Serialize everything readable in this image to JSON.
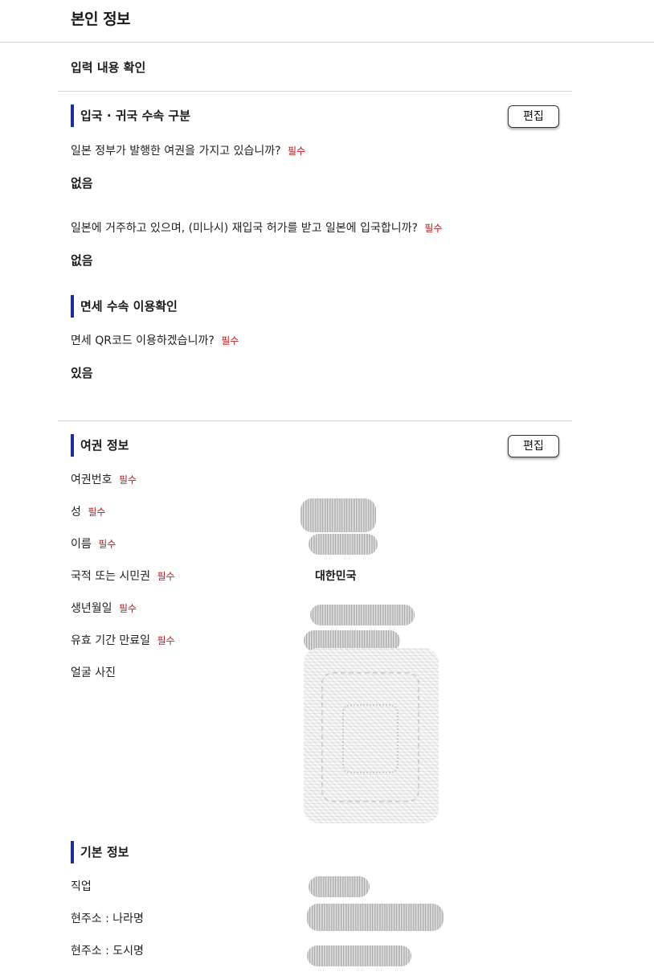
{
  "header": {
    "title": "본인 정보"
  },
  "confirm": {
    "title": "입력 내용 확인"
  },
  "required_label": "필수",
  "edit_label": "편집",
  "entry_section": {
    "title": "입국 · 귀국 수속 구분",
    "questions": [
      {
        "text": "일본 정부가 발행한 여권을 가지고 있습니까?",
        "answer": "없음"
      },
      {
        "text": "일본에 거주하고 있으며, (미나시) 재입국 허가를 받고 일본에 입국합니까?",
        "answer": "없음"
      }
    ]
  },
  "duty_free_section": {
    "title": "면세 수속 이용확인",
    "questions": [
      {
        "text": "면세 QR코드 이용하겠습니까?",
        "answer": "있음"
      }
    ]
  },
  "passport_section": {
    "title": "여권 정보",
    "fields": [
      {
        "label": "여권번호",
        "required": true
      },
      {
        "label": "성",
        "required": true
      },
      {
        "label": "이름",
        "required": true
      },
      {
        "label": "국적 또는 시민권",
        "required": true,
        "value": "대한민국"
      },
      {
        "label": "생년월일",
        "required": true
      },
      {
        "label": "유효 기간 만료일",
        "required": true
      },
      {
        "label": "얼굴 사진",
        "required": false
      }
    ]
  },
  "basic_section": {
    "title": "기본 정보",
    "fields": [
      {
        "label": "직업"
      },
      {
        "label": "현주소 : 나라명"
      },
      {
        "label": "현주소 : 도시명"
      }
    ]
  },
  "colors": {
    "accent_bar": "#1a2fa0",
    "required": "#c0181d"
  }
}
